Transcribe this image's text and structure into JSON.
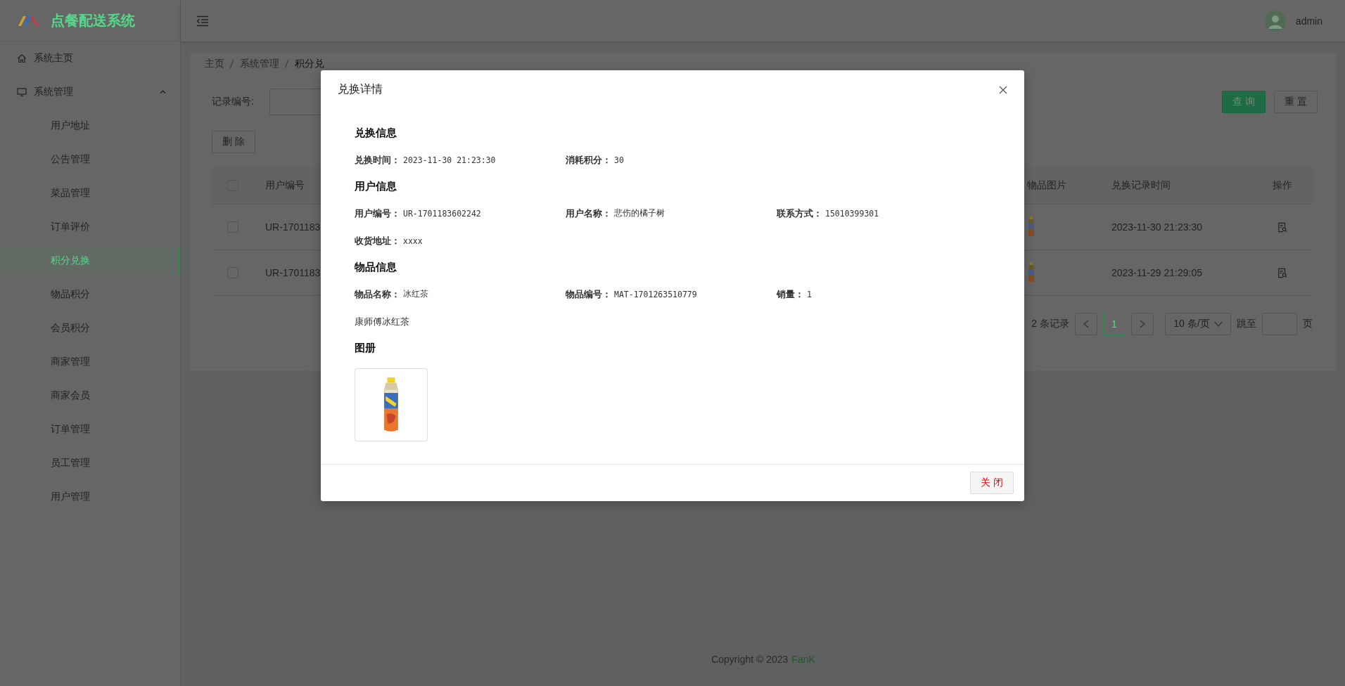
{
  "sidebar": {
    "brand": "点餐配送系统",
    "items": [
      {
        "label": "系统主页",
        "kind": "link"
      },
      {
        "label": "系统管理",
        "kind": "group",
        "expanded": true,
        "children": [
          {
            "label": "用户地址",
            "selected": false
          },
          {
            "label": "公告管理",
            "selected": false
          },
          {
            "label": "菜品管理",
            "selected": false
          },
          {
            "label": "订单评价",
            "selected": false
          },
          {
            "label": "积分兑换",
            "selected": true
          },
          {
            "label": "物品积分",
            "selected": false
          },
          {
            "label": "会员积分",
            "selected": false
          },
          {
            "label": "商家管理",
            "selected": false
          },
          {
            "label": "商家会员",
            "selected": false
          },
          {
            "label": "订单管理",
            "selected": false
          },
          {
            "label": "员工管理",
            "selected": false
          },
          {
            "label": "用户管理",
            "selected": false
          }
        ]
      }
    ]
  },
  "header": {
    "user": "admin"
  },
  "breadcrumb": [
    "主页",
    "系统管理",
    "积分兑"
  ],
  "search": {
    "label": "记录编号:",
    "query_button": "查 询",
    "reset_button": "重 置"
  },
  "toolbar": {
    "delete_button": "删 除"
  },
  "table": {
    "header_checked": false,
    "column_1": "用户编号",
    "columns_right": [
      "物品图片",
      "兑换记录时间",
      "操作"
    ],
    "rows": [
      {
        "checked": false,
        "user_id": "UR-1701183",
        "time": "2023-11-30 21:23:30"
      },
      {
        "checked": false,
        "user_id": "UR-1701183",
        "time": "2023-11-29 21:29:05"
      }
    ]
  },
  "pagination": {
    "total": "2 条记录",
    "pages": [
      {
        "label": "1",
        "selected": true
      }
    ],
    "page_size": "10 条/页",
    "jump_label": "跳至",
    "page_suffix": "页"
  },
  "footer": {
    "copyright": "Copyright © 2023",
    "author": "FanK"
  },
  "dialog": {
    "title": "兑换详情",
    "close_button": "关 闭",
    "sections": [
      {
        "heading": "兑换信息",
        "kind": "fields",
        "rows": [
          [
            {
              "label": "兑换时间：",
              "value": "2023-11-30 21:23:30"
            },
            {
              "label": "消耗积分：",
              "value": "30"
            }
          ]
        ]
      },
      {
        "heading": "用户信息",
        "kind": "fields",
        "rows": [
          [
            {
              "label": "用户编号：",
              "value": "UR-1701183602242"
            },
            {
              "label": "用户名称：",
              "value": "悲伤的橘子树"
            },
            {
              "label": "联系方式：",
              "value": "15010399301"
            }
          ],
          [
            {
              "label": "收货地址：",
              "value": "xxxx"
            }
          ]
        ]
      },
      {
        "heading": "物品信息",
        "kind": "fields",
        "rows": [
          [
            {
              "label": "物品名称：",
              "value": "冰红茶"
            },
            {
              "label": "物品编号：",
              "value": "MAT-1701263510779"
            },
            {
              "label": "销量：",
              "value": "1"
            }
          ]
        ],
        "note": "康师傅冰红茶"
      },
      {
        "heading": "图册",
        "kind": "gallery"
      }
    ]
  }
}
